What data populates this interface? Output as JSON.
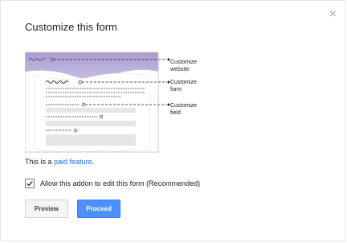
{
  "dialog": {
    "title": "Customize this form",
    "close_glyph": "×"
  },
  "annotations": [
    {
      "line1": "Customize",
      "line2": "website"
    },
    {
      "line1": "Customize",
      "line2": "form"
    },
    {
      "line1": "Customize",
      "line2": "field"
    }
  ],
  "paid": {
    "prefix": "This is a ",
    "link": "paid feature",
    "suffix": "."
  },
  "allow": {
    "label": "Allow this addon to edit this form (Recommended)",
    "checked": true
  },
  "buttons": {
    "preview": "Preview",
    "proceed": "Proceed"
  },
  "colors": {
    "accent": "#4d90fe",
    "header_purple": "#b7acd8",
    "link": "#1a73e8"
  }
}
